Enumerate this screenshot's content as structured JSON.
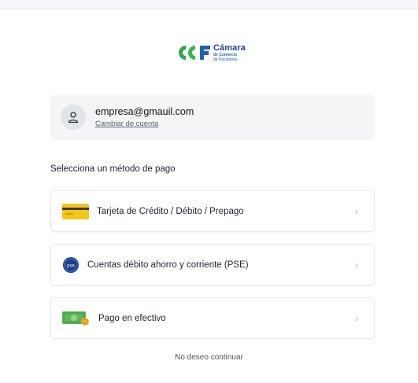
{
  "logo": {
    "line1": "Cámara",
    "line2": "de Comercio",
    "line3": "de Facatativá"
  },
  "account": {
    "email": "empresa@gmauil.com",
    "switch_label": "Cambiar de cuenta"
  },
  "payment": {
    "section_title": "Selecciona un método de pago",
    "options": [
      {
        "label": "Tarjeta de Crédito / Débito / Prepago",
        "icon": "credit-card-icon",
        "color": "#f5c518"
      },
      {
        "label": "Cuentas débito ahorro y corriente (PSE)",
        "icon": "pse-icon",
        "color": "#1a3e86"
      },
      {
        "label": "Pago en efectivo",
        "icon": "cash-icon",
        "color": "#5cb85c"
      }
    ]
  },
  "footer": {
    "no_continue": "No deseo continuar"
  },
  "colors": {
    "brand_blue": "#243f8f",
    "brand_green": "#2fa84f",
    "card_yellow": "#f5c518",
    "pse_blue": "#1a3e86",
    "cash_green": "#5cb85c"
  }
}
